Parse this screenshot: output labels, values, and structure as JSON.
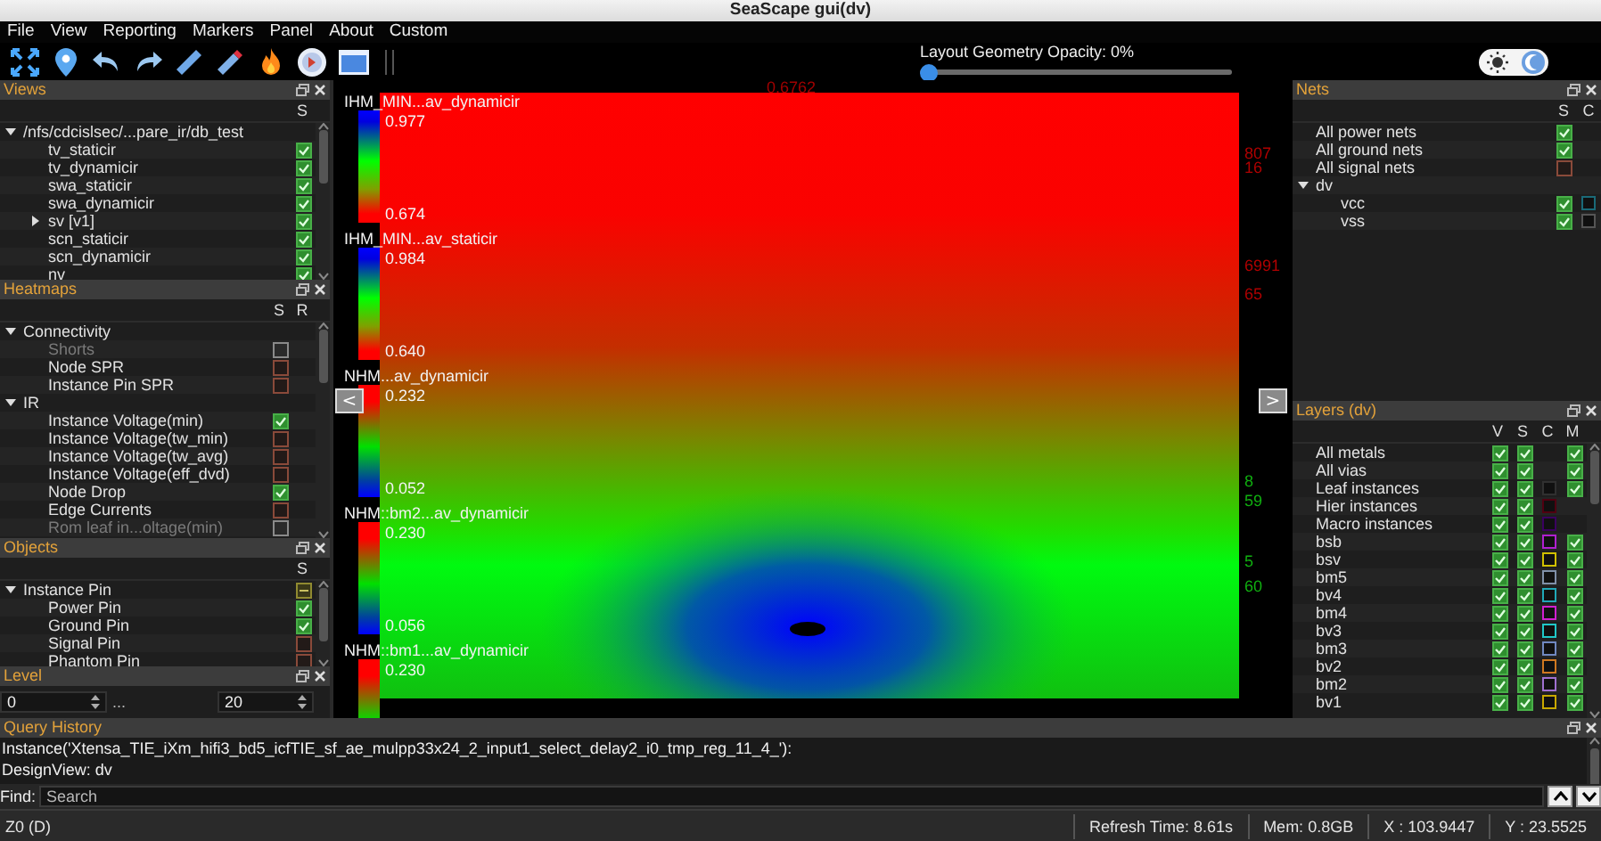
{
  "window": {
    "title": "SeaScape gui(dv)"
  },
  "menu": [
    "File",
    "View",
    "Reporting",
    "Markers",
    "Panel",
    "About",
    "Custom"
  ],
  "toolbar": {
    "opacity": {
      "label": "Layout Geometry Opacity: 0%",
      "level": 0
    }
  },
  "views": {
    "title": "Views",
    "columns": [
      "S"
    ],
    "items": [
      {
        "label": "/nfs/cdcislsec/...pare_ir/db_test",
        "expanded": true,
        "children": [
          {
            "label": "tv_staticir",
            "cells": [
              {
                "checked": true
              }
            ]
          },
          {
            "label": "tv_dynamicir",
            "cells": [
              {
                "checked": true
              }
            ]
          },
          {
            "label": "swa_staticir",
            "cells": [
              {
                "checked": true
              }
            ]
          },
          {
            "label": "swa_dynamicir",
            "cells": [
              {
                "checked": true
              }
            ]
          },
          {
            "label": "sv [v1]",
            "expanded": false,
            "cells": [
              {
                "checked": true
              }
            ]
          },
          {
            "label": "scn_staticir",
            "cells": [
              {
                "checked": true
              }
            ]
          },
          {
            "label": "scn_dynamicir",
            "cells": [
              {
                "checked": true
              }
            ]
          },
          {
            "label": "nv",
            "cells": [
              {
                "checked": true
              }
            ]
          }
        ]
      }
    ]
  },
  "heatmaps": {
    "title": "Heatmaps",
    "columns": [
      "S",
      "R"
    ],
    "items": [
      {
        "label": "Connectivity",
        "expanded": true,
        "children": [
          {
            "label": "Shorts",
            "disabled": true,
            "cells": [
              {
                "checked": false
              }
            ]
          },
          {
            "label": "Node SPR",
            "disabled": false,
            "cells": [
              {
                "checked": false
              }
            ]
          },
          {
            "label": "Instance Pin SPR",
            "disabled": false,
            "cells": [
              {
                "checked": false
              }
            ]
          }
        ]
      },
      {
        "label": "IR",
        "expanded": true,
        "children": [
          {
            "label": "Instance Voltage(min)",
            "disabled": false,
            "cells": [
              {
                "checked": true
              }
            ]
          },
          {
            "label": "Instance Voltage(tw_min)",
            "disabled": false,
            "cells": [
              {
                "checked": false
              }
            ]
          },
          {
            "label": "Instance Voltage(tw_avg)",
            "disabled": false,
            "cells": [
              {
                "checked": false
              }
            ]
          },
          {
            "label": "Instance Voltage(eff_dvd)",
            "disabled": false,
            "cells": [
              {
                "checked": false
              }
            ]
          },
          {
            "label": "Node Drop",
            "disabled": false,
            "cells": [
              {
                "checked": true
              }
            ]
          },
          {
            "label": "Edge Currents",
            "disabled": false,
            "cells": [
              {
                "checked": false
              }
            ]
          },
          {
            "label": "Rom leaf in...oltage(min)",
            "disabled": true,
            "cells": [
              {
                "checked": false
              }
            ]
          }
        ]
      }
    ]
  },
  "objects": {
    "title": "Objects",
    "columns": [
      "S"
    ],
    "items": [
      {
        "label": "Instance Pin",
        "expanded": true,
        "cells": [
          {
            "mixed": true
          }
        ],
        "children": [
          {
            "label": "Power Pin",
            "cells": [
              {
                "checked": true
              }
            ]
          },
          {
            "label": "Ground Pin",
            "cells": [
              {
                "checked": true
              }
            ]
          },
          {
            "label": "Signal Pin",
            "cells": [
              {
                "checked": false
              }
            ]
          },
          {
            "label": "Phantom Pin",
            "cells": [
              {
                "checked": false
              }
            ]
          }
        ]
      }
    ]
  },
  "level": {
    "title": "Level",
    "from": "0",
    "separator": "...",
    "to": "20"
  },
  "nets": {
    "title": "Nets",
    "columns": [
      "S",
      "C"
    ],
    "items": [
      {
        "label": "All power nets",
        "cells": [
          {
            "checked": true
          }
        ]
      },
      {
        "label": "All ground nets",
        "cells": [
          {
            "checked": true
          }
        ]
      },
      {
        "label": "All signal nets",
        "cells": [
          {
            "checked": false
          }
        ]
      },
      {
        "label": "dv",
        "expanded": true,
        "children": [
          {
            "label": "vcc",
            "cells": [
              {
                "checked": true
              },
              {
                "color": "#1a6a78"
              }
            ]
          },
          {
            "label": "vss",
            "cells": [
              {
                "checked": true
              },
              {
                "color": "#555555"
              }
            ]
          }
        ]
      }
    ]
  },
  "layers": {
    "title": "Layers (dv)",
    "columns": [
      "V",
      "S",
      "C",
      "M"
    ],
    "items": [
      {
        "label": "All metals",
        "cells": [
          {
            "checked": true
          },
          {
            "checked": true
          },
          null,
          {
            "checked": true
          }
        ]
      },
      {
        "label": "All vias",
        "cells": [
          {
            "checked": true
          },
          {
            "checked": true
          },
          null,
          {
            "checked": true
          }
        ]
      },
      {
        "label": "Leaf instances",
        "cells": [
          {
            "checked": true
          },
          {
            "checked": true
          },
          {
            "color": "#303030"
          },
          {
            "checked": true
          }
        ]
      },
      {
        "label": "Hier instances",
        "cells": [
          {
            "checked": true
          },
          {
            "checked": true
          },
          {
            "color": "#500010"
          }
        ]
      },
      {
        "label": "Macro instances",
        "cells": [
          {
            "checked": true
          },
          {
            "checked": true
          },
          {
            "color": "#3a0060"
          }
        ]
      },
      {
        "label": "bsb",
        "cells": [
          {
            "checked": true
          },
          {
            "checked": true
          },
          {
            "color": "#b020d0"
          },
          {
            "checked": true
          }
        ]
      },
      {
        "label": "bsv",
        "cells": [
          {
            "checked": true
          },
          {
            "checked": true
          },
          {
            "color": "#d0c000"
          },
          {
            "checked": true
          }
        ]
      },
      {
        "label": "bm5",
        "cells": [
          {
            "checked": true
          },
          {
            "checked": true
          },
          {
            "color": "#8090a8"
          },
          {
            "checked": true
          }
        ]
      },
      {
        "label": "bv4",
        "cells": [
          {
            "checked": true
          },
          {
            "checked": true
          },
          {
            "color": "#20a8b8"
          },
          {
            "checked": true
          }
        ]
      },
      {
        "label": "bm4",
        "cells": [
          {
            "checked": true
          },
          {
            "checked": true
          },
          {
            "color": "#d020d0"
          },
          {
            "checked": true
          }
        ]
      },
      {
        "label": "bv3",
        "cells": [
          {
            "checked": true
          },
          {
            "checked": true
          },
          {
            "color": "#20c8c8"
          },
          {
            "checked": true
          }
        ]
      },
      {
        "label": "bm3",
        "cells": [
          {
            "checked": true
          },
          {
            "checked": true
          },
          {
            "color": "#7088c0"
          },
          {
            "checked": true
          }
        ]
      },
      {
        "label": "bv2",
        "cells": [
          {
            "checked": true
          },
          {
            "checked": true
          },
          {
            "color": "#d07820"
          },
          {
            "checked": true
          }
        ]
      },
      {
        "label": "bm2",
        "cells": [
          {
            "checked": true
          },
          {
            "checked": true
          },
          {
            "color": "#a070d0"
          },
          {
            "checked": true
          }
        ]
      },
      {
        "label": "bv1",
        "cells": [
          {
            "checked": true
          },
          {
            "checked": true
          },
          {
            "color": "#c8a800"
          },
          {
            "checked": true
          }
        ]
      }
    ]
  },
  "canvas": {
    "legends": [
      {
        "title": "IHM_MIN...av_dynamicir",
        "max": "0.977",
        "min": "0.674",
        "kind": "cold-top"
      },
      {
        "title": "IHM_MIN...av_staticir",
        "max": "0.984",
        "min": "0.640",
        "kind": "cold-top"
      },
      {
        "title": "NHM...av_dynamicir",
        "max": "0.232",
        "min": "0.052",
        "kind": "hot-top"
      },
      {
        "title": "NHM::bm2...av_dynamicir",
        "max": "0.230",
        "min": "0.056",
        "kind": "hot-top"
      },
      {
        "title": "NHM::bm1...av_dynamicir",
        "max": "0.230",
        "kind": "hot-top"
      }
    ],
    "labels": [
      {
        "text": "0.6762",
        "color": "#a00000"
      },
      {
        "text": "807",
        "color": "#b00000"
      },
      {
        "text": "16",
        "color": "#b00000"
      },
      {
        "text": "6991",
        "color": "#b00000"
      },
      {
        "text": "65",
        "color": "#b00000"
      },
      {
        "text": "8",
        "color": "#10b010"
      },
      {
        "text": "59",
        "color": "#10b010"
      },
      {
        "text": "5",
        "color": "#10b010"
      },
      {
        "text": "60",
        "color": "#10b010"
      }
    ],
    "prev": "<",
    "next": ">"
  },
  "query_history": {
    "title": "Query History",
    "lines": [
      "Instance('Xtensa_TIE_iXm_hifi3_bd5_icfTIE_sf_ae_mulpp33x24_2_input1_select_delay2_i0_tmp_reg_11_4_'):",
      "DesignView: dv"
    ]
  },
  "find": {
    "label": "Find:",
    "placeholder": "Search"
  },
  "status_bar": {
    "left": "Z0 (D)",
    "items": [
      "Refresh Time: 8.61s",
      "Mem: 0.8GB",
      "X : 103.9447",
      "Y : 23.5525"
    ]
  }
}
